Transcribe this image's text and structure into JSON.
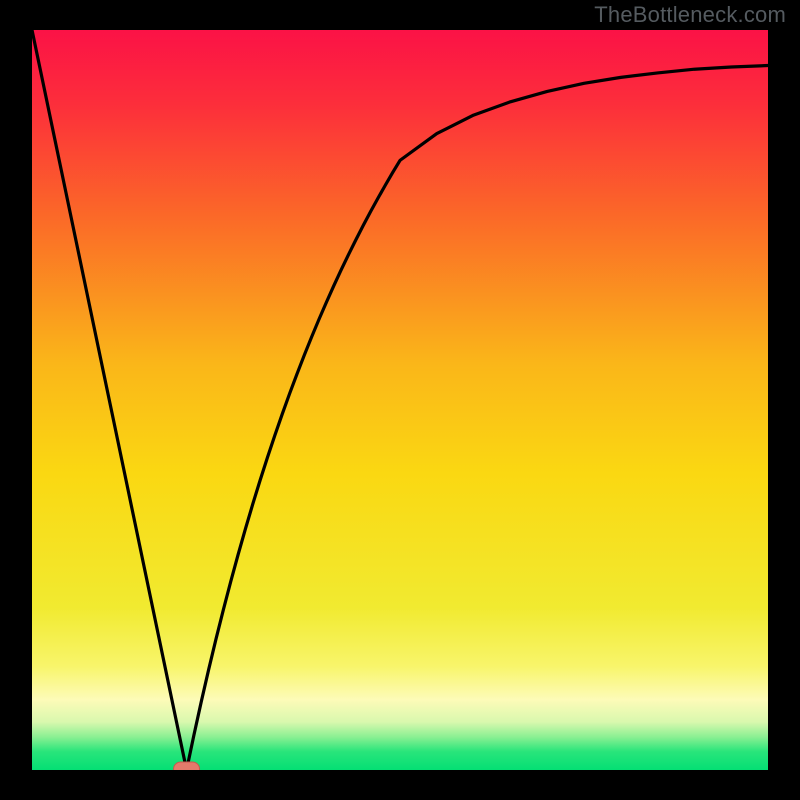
{
  "watermark": "TheBottleneck.com",
  "colors": {
    "gradient_stops": [
      {
        "offset": 0.0,
        "color": "#fb1246"
      },
      {
        "offset": 0.1,
        "color": "#fc2e3b"
      },
      {
        "offset": 0.25,
        "color": "#fb6828"
      },
      {
        "offset": 0.45,
        "color": "#fab619"
      },
      {
        "offset": 0.6,
        "color": "#fad812"
      },
      {
        "offset": 0.78,
        "color": "#f1ea30"
      },
      {
        "offset": 0.86,
        "color": "#f8f56b"
      },
      {
        "offset": 0.905,
        "color": "#fdfbb8"
      },
      {
        "offset": 0.935,
        "color": "#d9f8ae"
      },
      {
        "offset": 0.955,
        "color": "#8cf093"
      },
      {
        "offset": 0.975,
        "color": "#29e57b"
      },
      {
        "offset": 1.0,
        "color": "#04df74"
      }
    ],
    "curve": "#000000",
    "marker_fill": "#e47a6b",
    "marker_stroke": "#c9584c",
    "frame": "#000000"
  },
  "chart_data": {
    "type": "line",
    "title": "",
    "xlabel": "",
    "ylabel": "",
    "xlim": [
      0,
      100
    ],
    "ylim": [
      0,
      100
    ],
    "x": [
      0,
      1,
      2,
      3,
      4,
      5,
      6,
      7,
      8,
      9,
      10,
      11,
      12,
      13,
      14,
      15,
      16,
      17,
      18,
      19,
      20,
      21,
      22,
      23,
      24,
      25,
      26,
      27,
      28,
      29,
      30,
      31,
      32,
      33,
      34,
      35,
      36,
      37,
      38,
      39,
      40,
      41,
      42,
      43,
      44,
      45,
      46,
      47,
      48,
      49,
      50,
      55,
      60,
      65,
      70,
      75,
      80,
      85,
      90,
      95,
      100
    ],
    "y": [
      100,
      95.24,
      90.48,
      85.71,
      80.95,
      76.19,
      71.43,
      66.67,
      61.9,
      57.14,
      52.38,
      47.62,
      42.86,
      38.1,
      33.33,
      28.57,
      23.81,
      19.05,
      14.29,
      9.52,
      4.76,
      0,
      4.72,
      9.24,
      13.56,
      17.7,
      21.66,
      25.46,
      29.1,
      32.59,
      35.95,
      39.17,
      42.26,
      45.24,
      48.1,
      50.86,
      53.51,
      56.07,
      58.54,
      60.92,
      63.21,
      65.43,
      67.57,
      69.64,
      71.64,
      73.58,
      75.45,
      77.26,
      79.02,
      80.73,
      82.38,
      86.0,
      88.5,
      90.3,
      91.7,
      92.8,
      93.6,
      94.2,
      94.7,
      95.0,
      95.2
    ],
    "marker": {
      "x": 21,
      "y": 0
    }
  }
}
